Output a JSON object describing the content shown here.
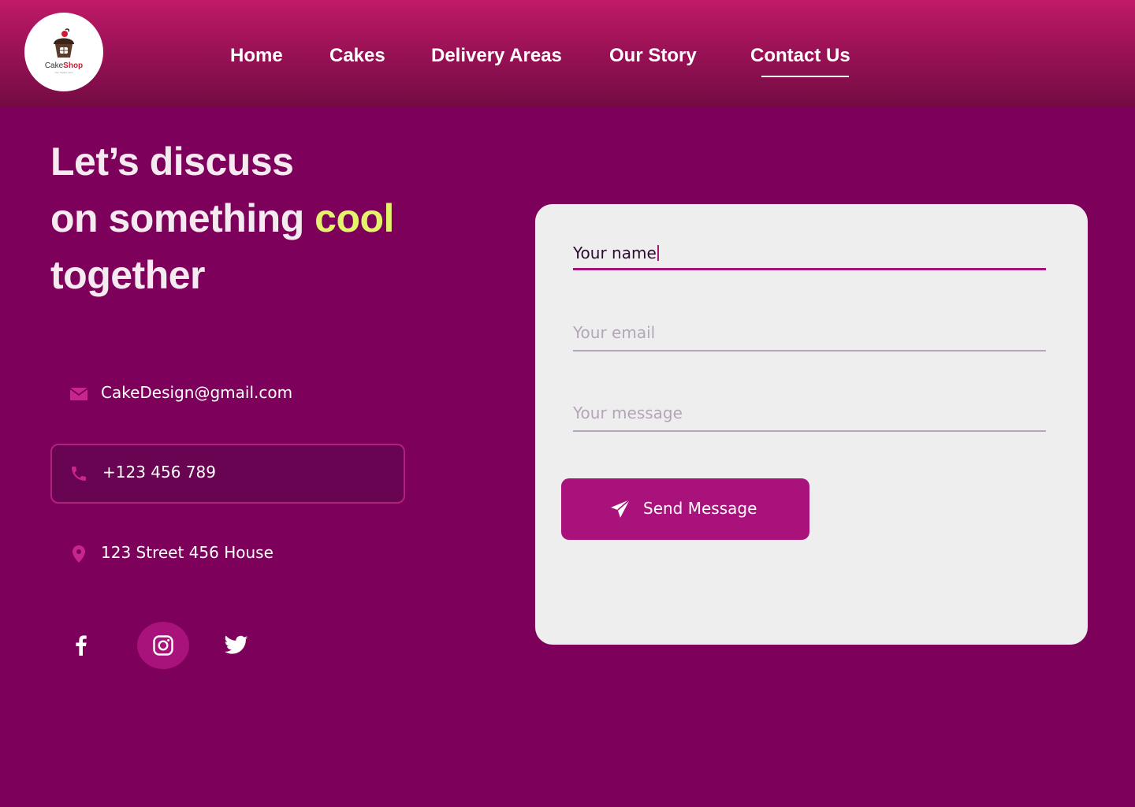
{
  "brand": {
    "name_part1": "Cake",
    "name_part2": "Shop",
    "tagline": "Your Tagline Here"
  },
  "nav": {
    "items": [
      {
        "label": "Home"
      },
      {
        "label": "Cakes"
      },
      {
        "label": "Delivery Areas"
      },
      {
        "label": "Our Story"
      },
      {
        "label": "Contact Us",
        "active": true
      }
    ]
  },
  "hero": {
    "line1": "Let’s discuss",
    "line2_start": "on something ",
    "line2_accent": "cool",
    "line3": "together"
  },
  "contact": {
    "email": "CakeDesign@gmail.com",
    "phone": "+123 456 789",
    "address": "123 Street 456 House"
  },
  "social": {
    "items": [
      "facebook-icon",
      "instagram-icon",
      "twitter-icon"
    ],
    "active": "instagram-icon"
  },
  "form": {
    "name_value": "Your name",
    "email_placeholder": "Your email",
    "message_placeholder": "Your message",
    "send_label": "Send Message"
  },
  "colors": {
    "background": "#7d005b",
    "accent_text": "#e3f36a",
    "button": "#a8127a",
    "card": "#eeeeee"
  }
}
